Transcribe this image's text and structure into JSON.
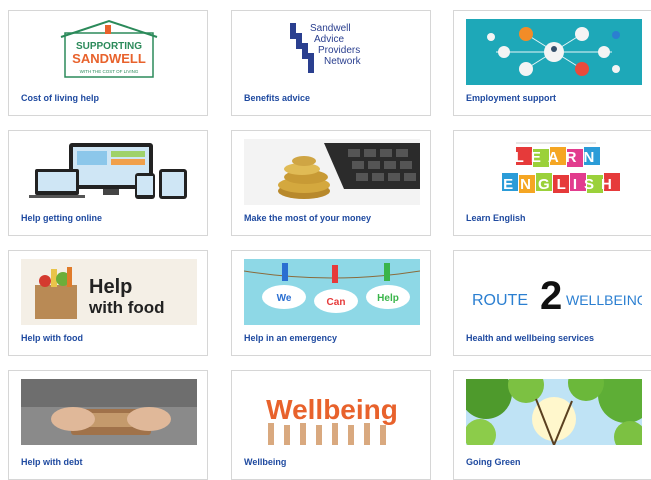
{
  "cards": [
    {
      "label": "Cost of living help",
      "image_text": [
        "SUPPORTING",
        "SANDWELL",
        "WITH THE COST OF LIVING"
      ]
    },
    {
      "label": "Benefits advice",
      "image_text": [
        "Sandwell",
        "Advice",
        "Providers",
        "Network"
      ]
    },
    {
      "label": "Employment support"
    },
    {
      "label": "Help getting online"
    },
    {
      "label": "Make the most of your money"
    },
    {
      "label": "Learn English",
      "image_text": [
        "LEARN",
        "ENGLISH"
      ]
    },
    {
      "label": "Help with food",
      "image_text": [
        "Help",
        "with food"
      ]
    },
    {
      "label": "Help in an emergency",
      "image_text": [
        "We",
        "Can",
        "Help"
      ]
    },
    {
      "label": "Health and wellbeing services",
      "image_text": [
        "ROUTE",
        "2",
        "WELLBEING"
      ]
    },
    {
      "label": "Help with debt"
    },
    {
      "label": "Wellbeing",
      "image_text": [
        "Wellbeing"
      ]
    },
    {
      "label": "Going Green"
    }
  ],
  "colors": {
    "link": "#1f4aa0",
    "border": "#d6d6d6"
  },
  "icons": [
    "house-logo",
    "devices-illustration",
    "coins-calculator-photo",
    "food-bag-icon",
    "hands-wallet-photo",
    "trees-photo"
  ]
}
